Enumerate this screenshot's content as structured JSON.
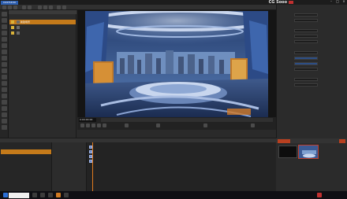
{
  "app": {
    "logo": "CGSTUDIO",
    "menu": [
      "",
      "",
      "",
      "",
      "",
      "",
      "",
      "",
      "",
      "",
      "",
      ""
    ],
    "brand": "CG Sooo"
  },
  "viewport": {
    "frame_counter": "0:00:00:00"
  },
  "scene_tree": {
    "rows": [
      {
        "label": "新建场景",
        "selected": true
      },
      {
        "label": "",
        "selected": false
      },
      {
        "label": "",
        "selected": false
      }
    ]
  },
  "lower": {
    "tabs": [
      "",
      "",
      "",
      "",
      "",
      "",
      "",
      "",
      "",
      "",
      "",
      "",
      ""
    ],
    "tracks": [
      {
        "label": "",
        "selected": false
      },
      {
        "label": "",
        "selected": true
      },
      {
        "label": "",
        "selected": false
      },
      {
        "label": "",
        "selected": false
      }
    ]
  },
  "taskbar": {
    "search": "",
    "time": "",
    "date": ""
  },
  "colors": {
    "accent_orange": "#c47a1a",
    "selection_blue": "#2d4e86",
    "preview_red": "#b84020"
  }
}
